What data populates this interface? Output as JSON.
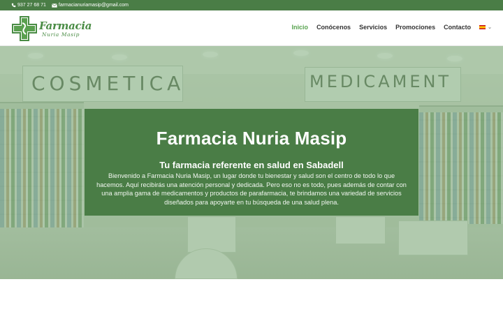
{
  "topbar": {
    "phone": "937 27 68 71",
    "email": "farmacianuriamasip@gmail.com",
    "phone_icon": "phone-icon",
    "email_icon": "envelope-icon"
  },
  "logo": {
    "name": "Farmacia",
    "sub": "Nuria Masip",
    "icon": "pharmacy-cross-icon"
  },
  "nav": {
    "items": [
      {
        "label": "Inicio",
        "active": true
      },
      {
        "label": "Conócenos",
        "active": false
      },
      {
        "label": "Servicios",
        "active": false
      },
      {
        "label": "Promociones",
        "active": false
      },
      {
        "label": "Contacto",
        "active": false
      }
    ],
    "language_flag": "spain-flag-icon",
    "language_chevron": "chevron-down-icon"
  },
  "hero": {
    "background_signs": [
      "COSMETICA",
      "MEDICAMENT"
    ],
    "title": "Farmacia Nuria Masip",
    "subtitle": "Tu farmacia referente en salud en Sabadell",
    "description": "Bienvenido a Farmacia Nuria Masip, un lugar donde tu bienestar y salud son el centro de todo lo que hacemos. Aquí recibirás una atención personal y dedicada. Pero eso no es todo, pues además de contar con una amplia gama de medicamentos y productos de parafarmacia, te brindamos una variedad de servicios diseñados para apoyarte en tu búsqueda de una salud plena."
  },
  "colors": {
    "brand_green": "#4a7d46",
    "nav_active": "#58a34f",
    "nav_text": "#333333"
  }
}
